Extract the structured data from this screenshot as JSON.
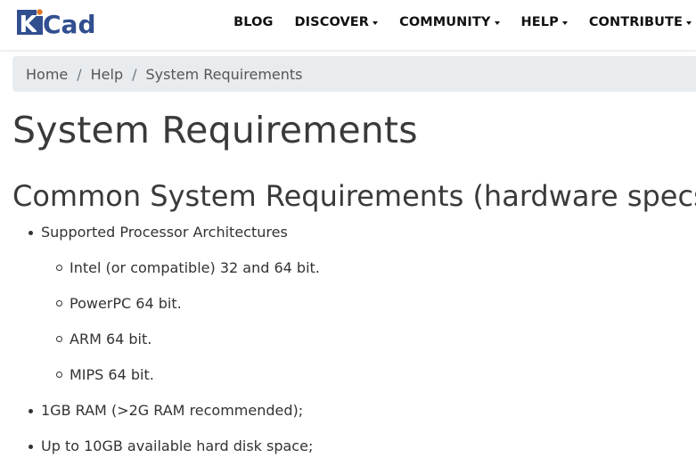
{
  "brand": {
    "logo_text_k": "K",
    "logo_text_i": "i",
    "logo_text_cad": "Cad",
    "logo_color": "#314e8f",
    "logo_dot_color": "#e2762c"
  },
  "nav": {
    "items": [
      {
        "label": "BLOG",
        "dropdown": false
      },
      {
        "label": "DISCOVER",
        "dropdown": true
      },
      {
        "label": "COMMUNITY",
        "dropdown": true
      },
      {
        "label": "HELP",
        "dropdown": true
      },
      {
        "label": "CONTRIBUTE",
        "dropdown": true
      }
    ]
  },
  "breadcrumb": {
    "items": [
      "Home",
      "Help",
      "System Requirements"
    ],
    "separator": "/"
  },
  "page": {
    "title": "System Requirements",
    "section_title": "Common System Requirements (hardware specs)"
  },
  "requirements": {
    "item_0": "Supported Processor Architectures",
    "architectures": [
      "Intel (or compatible) 32 and 64 bit.",
      "PowerPC 64 bit.",
      "ARM 64 bit.",
      "MIPS 64 bit."
    ],
    "item_1": "1GB RAM (>2G RAM recommended);",
    "item_2": "Up to 10GB available hard disk space;"
  }
}
